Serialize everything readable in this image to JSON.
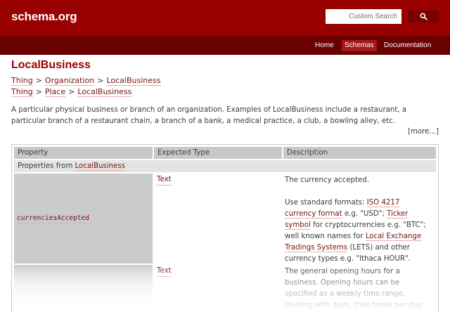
{
  "header": {
    "logo": "schema.org",
    "search_placeholder": "Custom Search",
    "nav": [
      "Home",
      "Schemas",
      "Documentation"
    ],
    "active_nav": "Schemas"
  },
  "page": {
    "title": "LocalBusiness",
    "breadcrumbs": [
      [
        "Thing",
        "Organization",
        "LocalBusiness"
      ],
      [
        "Thing",
        "Place",
        "LocalBusiness"
      ]
    ],
    "description": "A particular physical business or branch of an organization. Examples of LocalBusiness include a restaurant, a particular branch of a restaurant chain, a branch of a bank, a medical practice, a club, a bowling alley, etc.",
    "more_link": "[more...]"
  },
  "table": {
    "headers": [
      "Property",
      "Expected Type",
      "Description"
    ],
    "group_prefix": "Properties from ",
    "group_link": "LocalBusiness",
    "rows": [
      {
        "property": "currenciesAccepted",
        "type": "Text",
        "desc_line1": "The currency accepted.",
        "desc_part_a": "Use standard formats: ",
        "desc_link_iso": "ISO 4217 currency format",
        "desc_part_b": " e.g. \"USD\"; ",
        "desc_link_ticker": "Ticker symbol",
        "desc_part_c": " for cryptocurrencies e.g. \"BTC\"; well known names for ",
        "desc_link_lets": "Local Exchange Tradings Systems",
        "desc_part_d": " (LETS) and other currency types e.g. \"Ithaca HOUR\"."
      },
      {
        "property": "",
        "type": "Text",
        "desc": "The general opening hours for a business. Opening hours can be specified as a weekly time range, starting with days, then times per day. Multiple days can be listed"
      }
    ]
  },
  "colors": {
    "brand_red": "#990000",
    "nav_dark": "#6b0000",
    "link": "#7a1010",
    "header_gray": "#c8c8c8"
  }
}
